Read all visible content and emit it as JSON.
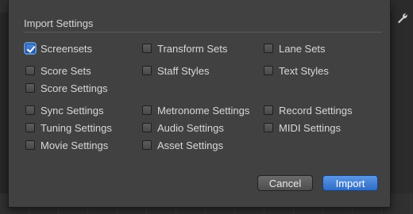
{
  "dialog": {
    "title": "Import Settings",
    "checkboxes": [
      {
        "label": "Screensets",
        "checked": true
      },
      {
        "label": "Transform Sets",
        "checked": false
      },
      {
        "label": "Lane Sets",
        "checked": false
      },
      {
        "label": "Score Sets",
        "checked": false
      },
      {
        "label": "Staff Styles",
        "checked": false
      },
      {
        "label": "Text Styles",
        "checked": false
      },
      {
        "label": "Score Settings",
        "checked": false
      },
      {
        "label": "Sync Settings",
        "checked": false
      },
      {
        "label": "Metronome Settings",
        "checked": false
      },
      {
        "label": "Record Settings",
        "checked": false
      },
      {
        "label": "Tuning Settings",
        "checked": false
      },
      {
        "label": "Audio Settings",
        "checked": false
      },
      {
        "label": "MIDI Settings",
        "checked": false
      },
      {
        "label": "Movie Settings",
        "checked": false
      },
      {
        "label": "Asset Settings",
        "checked": false
      }
    ],
    "buttons": {
      "cancel": "Cancel",
      "import": "Import"
    }
  },
  "colors": {
    "accent": "#3a78d4",
    "dialog_bg": "#414141",
    "text": "#d8d8d8"
  },
  "icons": {
    "toolbar_right": "wrench-icon"
  }
}
